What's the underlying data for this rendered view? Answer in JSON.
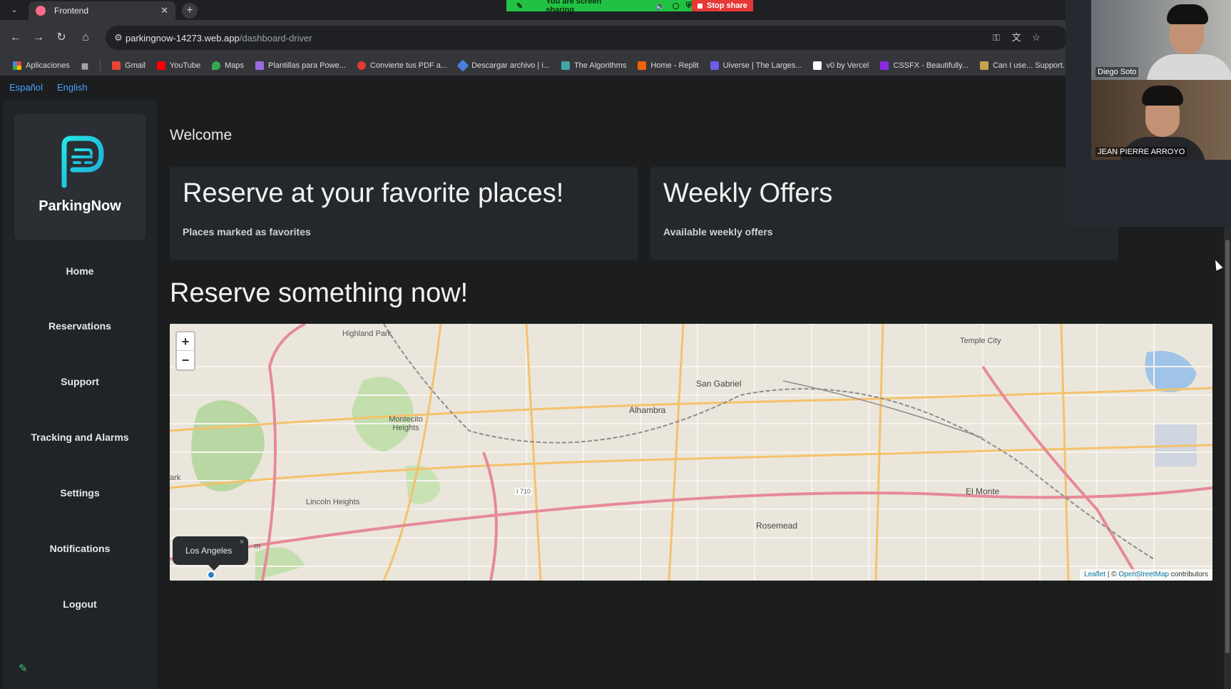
{
  "browser": {
    "tab_title": "Frontend",
    "url_host": "parkingnow-14273.web.app",
    "url_path": "/dashboard-driver",
    "bookmarks": [
      {
        "label": "Aplicaciones",
        "color": "#e94235"
      },
      {
        "label": "Gmail",
        "color": "#ea4335"
      },
      {
        "label": "YouTube",
        "color": "#ff0000"
      },
      {
        "label": "Maps",
        "color": "#34a853"
      },
      {
        "label": "Plantillas para Powe...",
        "color": "#9c6ade"
      },
      {
        "label": "Convierte tus PDF a...",
        "color": "#e53935"
      },
      {
        "label": "Descargar archivo | i...",
        "color": "#4a7fe0"
      },
      {
        "label": "The Algorithms",
        "color": "#3ea6a6"
      },
      {
        "label": "Home - Replit",
        "color": "#f26207"
      },
      {
        "label": "Uiverse | The Larges...",
        "color": "#6c5ce7"
      },
      {
        "label": "v0 by Vercel",
        "color": "#ffffff"
      },
      {
        "label": "CSSFX - Beautifully...",
        "color": "#8a2be2"
      },
      {
        "label": "Can I use... Support...",
        "color": "#c8a24a"
      }
    ]
  },
  "screen_share": {
    "message": "You are screen sharing",
    "stop_label": "Stop share"
  },
  "language": {
    "spanish": "Español",
    "english": "English"
  },
  "sidebar": {
    "brand": "ParkingNow",
    "items": [
      {
        "label": "Home"
      },
      {
        "label": "Reservations"
      },
      {
        "label": "Support"
      },
      {
        "label": "Tracking and Alarms"
      },
      {
        "label": "Settings"
      },
      {
        "label": "Notifications"
      },
      {
        "label": "Logout"
      }
    ]
  },
  "main": {
    "welcome": "Welcome",
    "cards": [
      {
        "title": "Reserve at your favorite places!",
        "subtitle": "Places marked as favorites"
      },
      {
        "title": "Weekly Offers",
        "subtitle": "Available weekly offers"
      }
    ],
    "reserve_title": "Reserve something now!"
  },
  "map": {
    "zoom_in": "+",
    "zoom_out": "−",
    "popup_text": "Los Angeles",
    "popup_close": "×",
    "attribution_leaflet": "Leaflet",
    "attribution_sep": "| ©",
    "attribution_osm": "OpenStreetMap",
    "attribution_rest": "contributors",
    "labels": {
      "highland_park": "Highland Park",
      "temple_city": "Temple City",
      "san_gabriel": "San Gabriel",
      "alhambra": "Alhambra",
      "montecito_heights": "Montecito Heights",
      "lincoln_heights": "Lincoln Heights",
      "rosemead": "Rosemead",
      "el_monte": "El Monte",
      "i710": "I 710",
      "ark": "ark",
      "m": "m"
    }
  },
  "video_call": {
    "participant_1": "Diego Soto",
    "participant_2": "JEAN PIERRE ARROYO"
  }
}
